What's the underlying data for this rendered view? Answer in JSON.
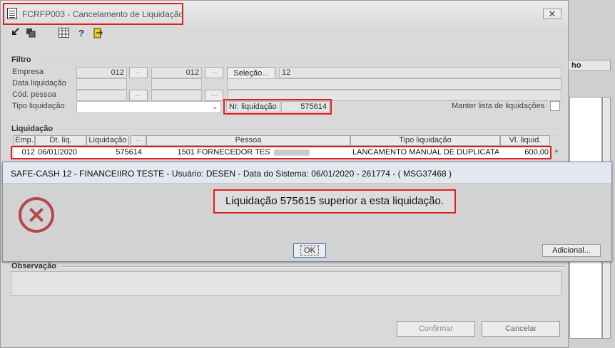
{
  "window": {
    "title": "FCRFP003 - Cancelamento de Liquidação",
    "close_glyph": "✕"
  },
  "toolbar": {
    "icons": [
      "arrow-icon",
      "copy-icon",
      "calendar-icon",
      "help-icon",
      "exit-icon"
    ]
  },
  "background": {
    "column_header": "ho"
  },
  "filtro": {
    "label": "Filtro",
    "empresa_label": "Empresa",
    "empresa_from": "012",
    "empresa_to": "012",
    "selecao_label": "Seleção...",
    "selecao_value": "12",
    "data_label": "Data liquidação",
    "pessoa_label": "Cód. pessoa",
    "tipo_label": "Tipo liquidação",
    "tipo_value": "",
    "nr_label": "Nr. liquidação",
    "nr_value": "575614",
    "manter_label": "Manter lista de liquidações"
  },
  "liquidacao": {
    "label": "Liquidação",
    "columns": [
      "Emp.",
      "Dt. liq.",
      "Liquidação",
      "Pessoa",
      "Tipo liquidação",
      "Vl. liquid."
    ],
    "row": {
      "emp": "012",
      "dt": "06/01/2020",
      "liquidacao": "575614",
      "pessoa_cod": "1501",
      "pessoa_nome": "FORNECEDOR TESTE",
      "tipo": "LANCAMENTO MANUAL DE DUPLICATA",
      "valor": "600,00"
    }
  },
  "observacao": {
    "label": "Observação"
  },
  "buttons": {
    "confirmar": "Confirmar",
    "cancelar": "Cancelar"
  },
  "dialog": {
    "title": "SAFE-CASH 12 - FINANCEIIRO TESTE - Usuário: DESEN - Data do Sistema: 06/01/2020 - 261774 - ( MSG37468 )",
    "message": "Liquidação 575615 superior a esta liquidação.",
    "ok": "OK",
    "adicional": "Adicional..."
  },
  "colors": {
    "highlight": "#e02020",
    "error": "#b5474b"
  }
}
